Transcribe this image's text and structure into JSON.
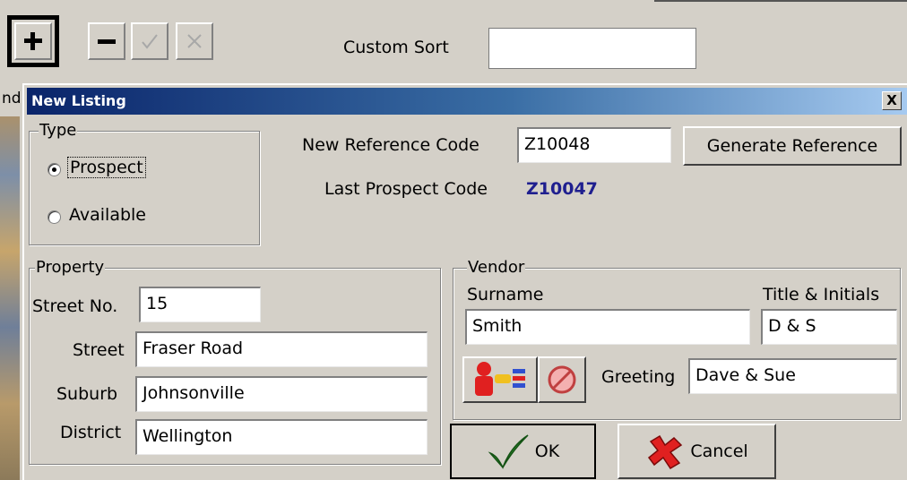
{
  "toolbar": {
    "custom_sort_label": "Custom Sort",
    "custom_sort_value": ""
  },
  "bg_left_fragment": "nd",
  "dialog": {
    "title": "New Listing",
    "close_label": "X",
    "type_group": {
      "legend": "Type",
      "options": [
        {
          "label": "Prospect",
          "checked": true
        },
        {
          "label": "Available",
          "checked": false
        }
      ]
    },
    "reference": {
      "new_label": "New Reference Code",
      "new_value": "Z10048",
      "generate_label": "Generate Reference",
      "last_label": "Last Prospect Code",
      "last_value": "Z10047",
      "last_value_color": "#1f1f8f"
    },
    "property": {
      "legend": "Property",
      "street_no_label": "Street No.",
      "street_no_value": "15",
      "street_label": "Street",
      "street_value": "Fraser Road",
      "suburb_label": "Suburb",
      "suburb_value": "Johnsonville",
      "district_label": "District",
      "district_value": "Wellington"
    },
    "vendor": {
      "legend": "Vendor",
      "surname_label": "Surname",
      "surname_value": "Smith",
      "title_label": "Title & Initials",
      "title_value": "D & S",
      "greeting_label": "Greeting",
      "greeting_value": "Dave & Sue",
      "contact_icon": "contact-lookup-icon",
      "clear_icon": "no-entry-icon"
    },
    "ok_label": "OK",
    "cancel_label": "Cancel"
  }
}
